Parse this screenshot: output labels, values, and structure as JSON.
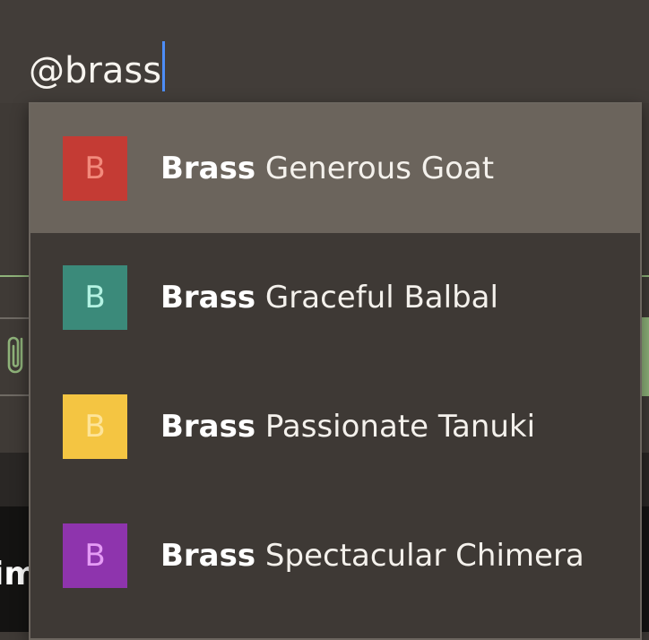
{
  "composer": {
    "input_value": "@brass"
  },
  "background": {
    "peek_text": "im"
  },
  "mention_dropdown": {
    "selected_index": 0,
    "items": [
      {
        "avatar_letter": "B",
        "avatar_bg": "#c43b34",
        "avatar_fg": "#f28a7c",
        "match": "Brass",
        "rest": " Generous Goat"
      },
      {
        "avatar_letter": "B",
        "avatar_bg": "#3b8a7a",
        "avatar_fg": "#b4f2e2",
        "match": "Brass",
        "rest": " Graceful Balbal"
      },
      {
        "avatar_letter": "B",
        "avatar_bg": "#f4c542",
        "avatar_fg": "#fde49a",
        "match": "Brass",
        "rest": " Passionate Tanuki"
      },
      {
        "avatar_letter": "B",
        "avatar_bg": "#8e34ad",
        "avatar_fg": "#e59cf5",
        "match": "Brass",
        "rest": " Spectacular Chimera"
      }
    ]
  }
}
